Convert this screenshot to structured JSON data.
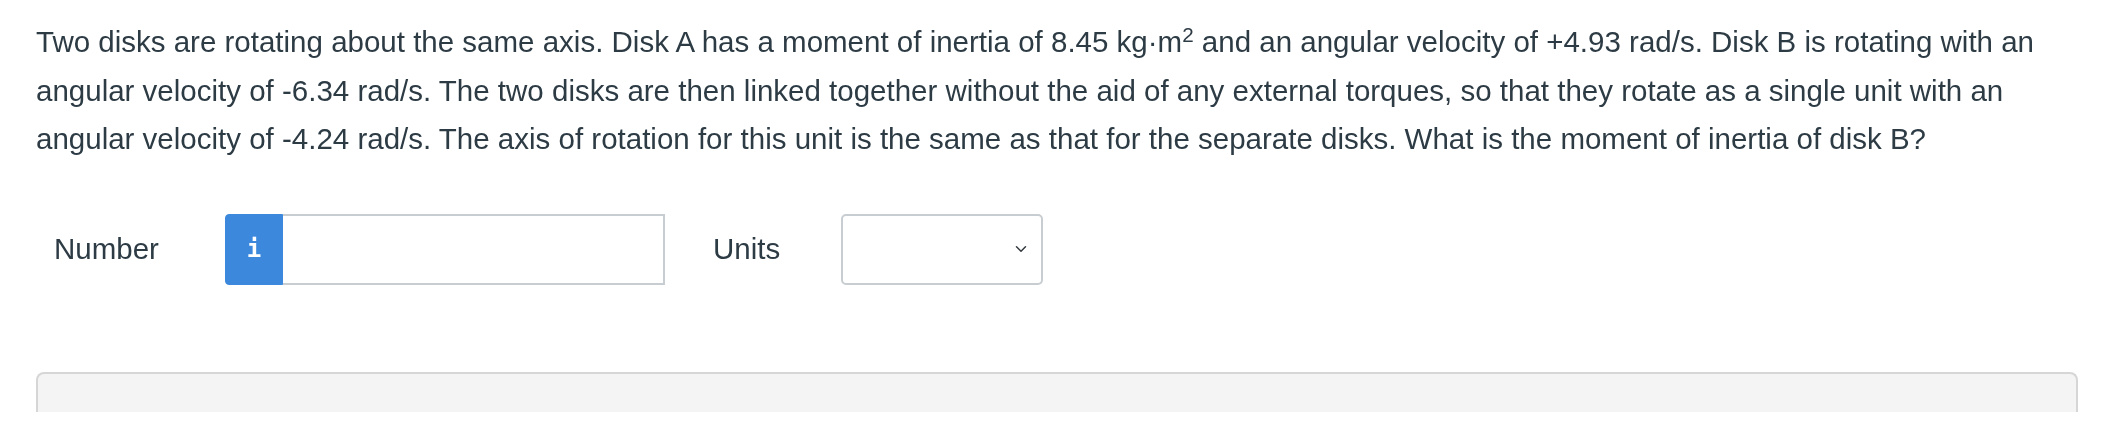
{
  "question": {
    "text": "Two disks are rotating about the same axis. Disk A has a moment of inertia of 8.45 kg·m$^{2}$ and an angular velocity of +4.93 rad/s. Disk B is rotating with an angular velocity of -6.34 rad/s. The two disks are then linked together without the aid of any external torques, so that they rotate as a single unit with an angular velocity of -4.24 rad/s. The axis of rotation for this unit is the same as that for the separate disks. What is the moment of inertia of disk B?"
  },
  "answer": {
    "number_label": "Number",
    "info_button": "i",
    "units_label": "Units"
  }
}
